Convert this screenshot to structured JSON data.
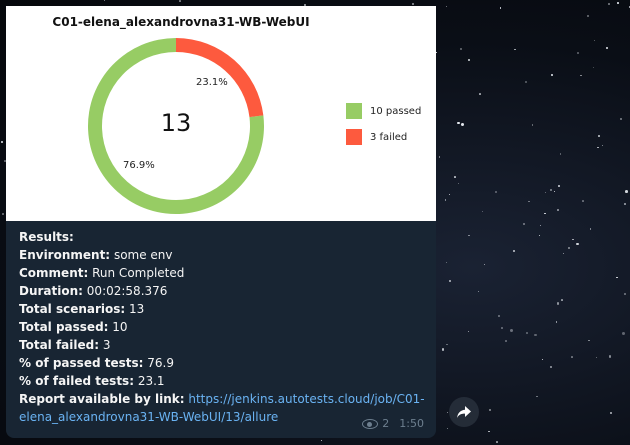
{
  "background": {
    "description": "starfield"
  },
  "chart": {
    "title": "C01-elena_alexandrovna31-WB-WebUI",
    "total": "13",
    "passed_pct_label": "76.9%",
    "failed_pct_label": "23.1%",
    "legend": {
      "passed": "10 passed",
      "failed": "3 failed"
    },
    "colors": {
      "passed": "#97cc64",
      "failed": "#fd5a3e"
    }
  },
  "chart_data": {
    "type": "pie",
    "title": "C01-elena_alexandrovna31-WB-WebUI",
    "categories": [
      "10 passed",
      "3 failed"
    ],
    "values": [
      10,
      3
    ],
    "percentages": [
      76.9,
      23.1
    ],
    "center_label": "13",
    "legend": "right"
  },
  "results": {
    "header": "Results:",
    "environment_label": "Environment:",
    "environment_value": "some env",
    "comment_label": "Comment:",
    "comment_value": "Run Completed",
    "duration_label": "Duration:",
    "duration_value": "00:02:58.376",
    "total_scenarios_label": "Total scenarios:",
    "total_scenarios_value": "13",
    "total_passed_label": "Total passed:",
    "total_passed_value": "10",
    "total_failed_label": "Total failed:",
    "total_failed_value": "3",
    "pct_passed_label": "% of passed tests:",
    "pct_passed_value": "76.9",
    "pct_failed_label": "% of failed tests:",
    "pct_failed_value": "23.1",
    "report_label": "Report available by link:",
    "report_link": "https://jenkins.autotests.cloud/job/C01-elena_alexandrovna31-WB-WebUI/13/allure"
  },
  "meta": {
    "views": "2",
    "time": "1:50"
  }
}
